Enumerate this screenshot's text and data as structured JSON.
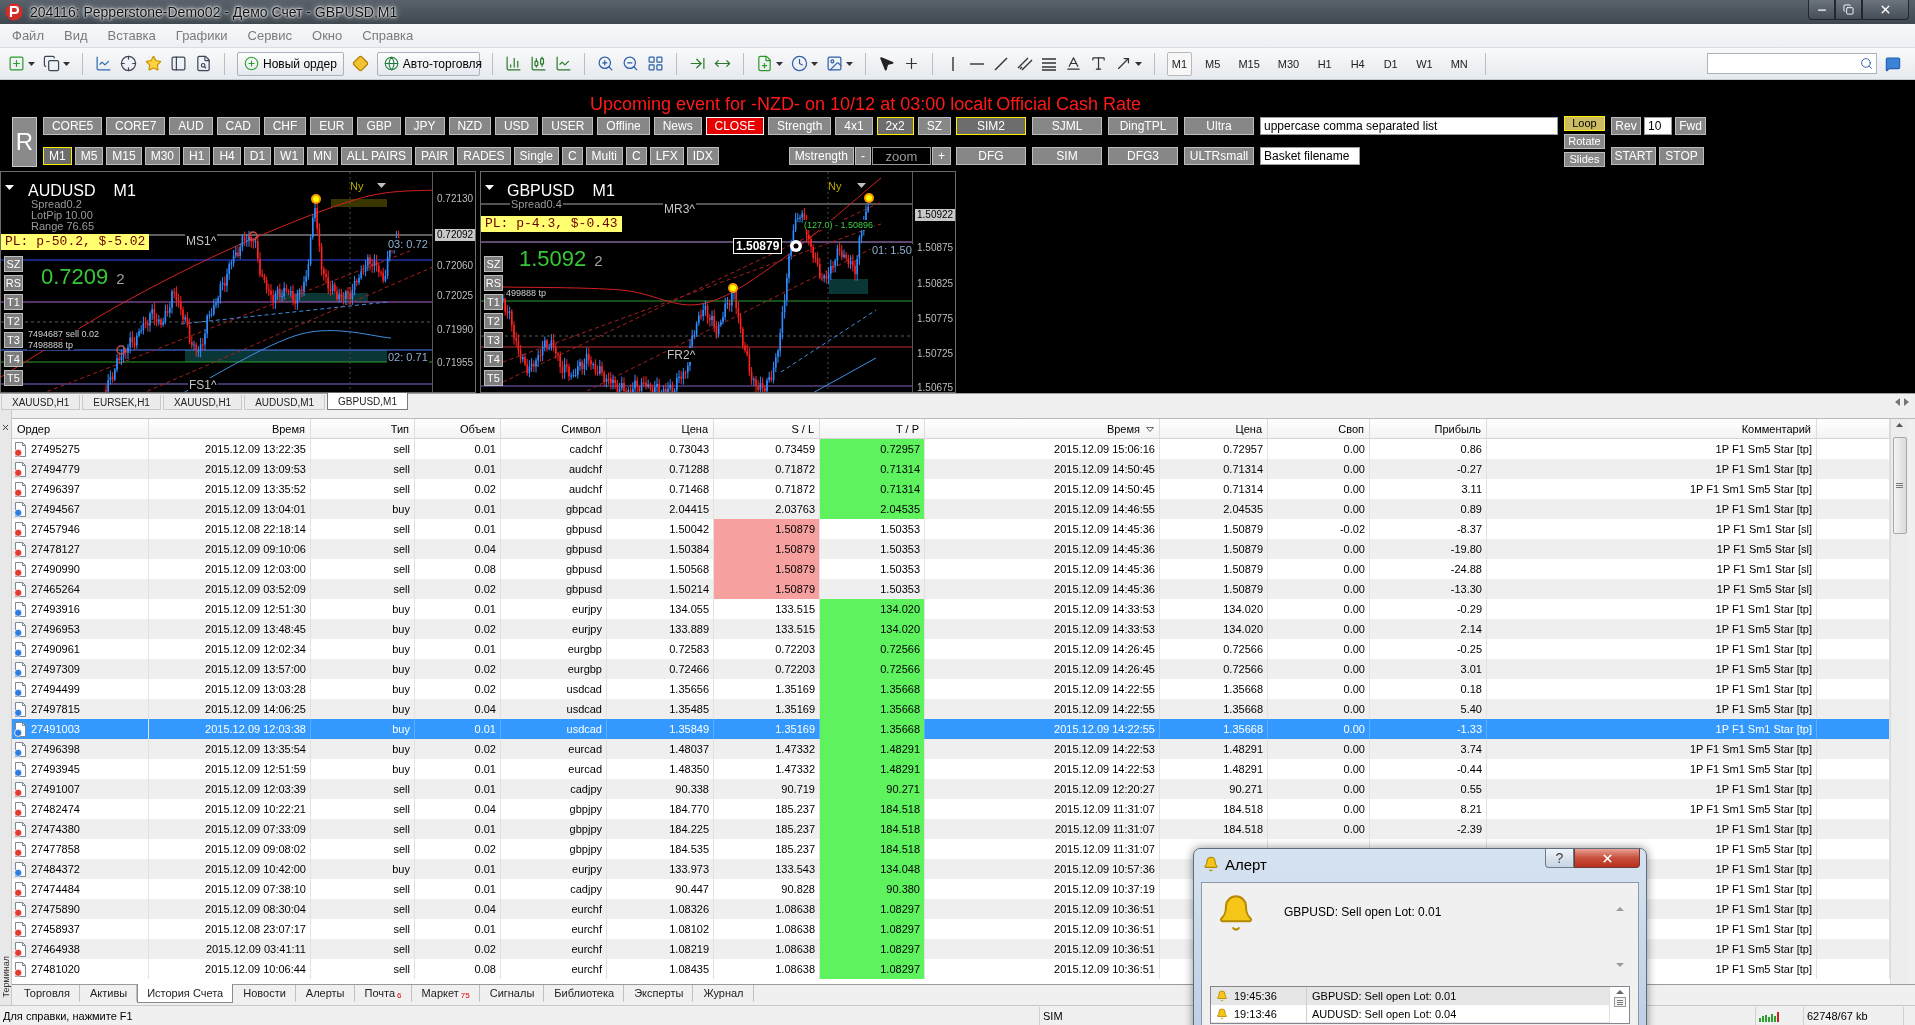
{
  "window": {
    "title": "204116: Pepperstone-Demo02 - Демо Счет - GBPUSD,M1"
  },
  "menu": [
    "Файл",
    "Вид",
    "Вставка",
    "Графики",
    "Сервис",
    "Окно",
    "Справка"
  ],
  "toolbar": {
    "new_order": "Новый ордер",
    "autotrading": "Авто-торговля",
    "periods": [
      {
        "label": "M1",
        "selected": true
      },
      {
        "label": "M5",
        "selected": false
      },
      {
        "label": "M15",
        "selected": false
      },
      {
        "label": "M30",
        "selected": false
      },
      {
        "label": "H1",
        "selected": false
      },
      {
        "label": "H4",
        "selected": false
      },
      {
        "label": "D1",
        "selected": false
      },
      {
        "label": "W1",
        "selected": false
      },
      {
        "label": "MN",
        "selected": false
      }
    ]
  },
  "panel": {
    "headline": [
      "Upcoming event for -NZD- on 10/12 at 03:00 localt",
      "Official Cash Rate"
    ],
    "r_button": "R",
    "row1": [
      {
        "label": "CORE5",
        "kind": "std",
        "selected": false
      },
      {
        "label": "CORE7",
        "kind": "std",
        "selected": false
      },
      {
        "label": "AUD",
        "kind": "std",
        "selected": false
      },
      {
        "label": "CAD",
        "kind": "std",
        "selected": false
      },
      {
        "label": "CHF",
        "kind": "std",
        "selected": false
      },
      {
        "label": "EUR",
        "kind": "std",
        "selected": false
      },
      {
        "label": "GBP",
        "kind": "std",
        "selected": false
      },
      {
        "label": "JPY",
        "kind": "std",
        "selected": false
      },
      {
        "label": "NZD",
        "kind": "std",
        "selected": false
      },
      {
        "label": "USD",
        "kind": "std",
        "selected": false
      },
      {
        "label": "USER",
        "kind": "std",
        "selected": false
      },
      {
        "label": "Offline",
        "kind": "std",
        "selected": false
      },
      {
        "label": "News",
        "kind": "std",
        "selected": false
      },
      {
        "label": "CLOSE",
        "kind": "alert",
        "selected": false
      },
      {
        "label": "Strength",
        "kind": "std",
        "selected": false
      },
      {
        "label": "4x1",
        "kind": "std",
        "selected": false
      },
      {
        "label": "2x2",
        "kind": "std",
        "selected": true
      },
      {
        "label": "SZ",
        "kind": "std",
        "selected": false
      }
    ],
    "row2": [
      {
        "label": "M1",
        "selected": true
      },
      {
        "label": "M5",
        "selected": false
      },
      {
        "label": "M15",
        "selected": false
      },
      {
        "label": "M30",
        "selected": false
      },
      {
        "label": "H1",
        "selected": false
      },
      {
        "label": "H4",
        "selected": false
      },
      {
        "label": "D1",
        "selected": false
      },
      {
        "label": "W1",
        "selected": false
      },
      {
        "label": "MN",
        "selected": false
      },
      {
        "label": "ALL PAIRS",
        "selected": false
      },
      {
        "label": "PAIR",
        "selected": false
      },
      {
        "label": "RADES",
        "selected": false
      },
      {
        "label": "Single",
        "selected": false
      },
      {
        "label": "C",
        "selected": false
      },
      {
        "label": "Multi",
        "selected": false
      },
      {
        "label": "C",
        "selected": false
      },
      {
        "label": "LFX",
        "selected": false
      },
      {
        "label": "IDX",
        "selected": false
      }
    ],
    "strength": {
      "label": "Mstrength",
      "minus": "-",
      "zoom": {
        "placeholder": "zoom"
      },
      "plus": "+"
    },
    "grid": [
      [
        {
          "label": "SIM2",
          "selected": true
        },
        {
          "label": "SJML",
          "selected": false
        },
        {
          "label": "DingTPL",
          "selected": false
        },
        {
          "label": "Ultra",
          "selected": false
        }
      ],
      [
        {
          "label": "DFG",
          "selected": false
        },
        {
          "label": "SIM",
          "selected": false
        },
        {
          "label": "DFG3",
          "selected": false
        },
        {
          "label": "ULTRsmall",
          "selected": false
        }
      ]
    ],
    "pairs_field": {
      "value": "uppercase comma separated list"
    },
    "basket_field": {
      "value": "Basket filename"
    },
    "slideshow": [
      {
        "label": "Loop",
        "selected": true
      },
      {
        "label": "Rotate",
        "selected": false
      },
      {
        "label": "Slides",
        "selected": false
      }
    ],
    "nav": {
      "rev": "Rev",
      "step": {
        "value": "10"
      },
      "fwd": "Fwd"
    },
    "run": [
      "START",
      "STOP"
    ]
  },
  "charts": [
    {
      "symbol": "AUDUSD",
      "period": "M1",
      "info": [
        "Spread0.2",
        "LotPip 10.00",
        "Range 76.65"
      ],
      "pl": "PL: p-50.2, $-5.02",
      "price": "0.7209",
      "price_digit": "2",
      "session": "Ny",
      "pivots": [
        "MS1^",
        "FS1^"
      ],
      "orders": [
        "7494687 sell 0.02",
        "7498888 tp"
      ],
      "targets": [
        "03: 0.72",
        "02: 0.71"
      ],
      "side_buttons": [
        "SZ",
        "RS",
        "T1",
        "T2",
        "T3",
        "T4",
        "T5"
      ],
      "axis": [
        {
          "label": "0.72130",
          "current": false
        },
        {
          "label": "0.72092",
          "current": true
        },
        {
          "label": "0.72060",
          "current": false
        },
        {
          "label": "0.72025",
          "current": false
        },
        {
          "label": "0.71990",
          "current": false
        },
        {
          "label": "0.71955",
          "current": false
        }
      ]
    },
    {
      "symbol": "GBPUSD",
      "period": "M1",
      "info": [
        "Spread0.4"
      ],
      "pl": "PL: p-4.3, $-0.43",
      "price": "1.5092",
      "price_digit": "2",
      "session": "Ny",
      "pivots": [
        "MR3^",
        "FR2^"
      ],
      "orders": [
        "499888 tp"
      ],
      "targets": [
        "01: 1.50"
      ],
      "marker": "1.50879",
      "level_text": "(127.0) - 1.50896",
      "side_buttons": [
        "SZ",
        "RS",
        "T1",
        "T2",
        "T3",
        "T4",
        "T5"
      ],
      "axis": [
        {
          "label": "1.50922",
          "current": true
        },
        {
          "label": "1.50875",
          "current": false
        },
        {
          "label": "1.50825",
          "current": false
        },
        {
          "label": "1.50775",
          "current": false
        },
        {
          "label": "1.50725",
          "current": false
        },
        {
          "label": "1.50675",
          "current": false
        }
      ]
    }
  ],
  "chart_tabs": [
    {
      "label": "XAUUSD,H1",
      "selected": false
    },
    {
      "label": "EURSEK,H1",
      "selected": false
    },
    {
      "label": "XAUUSD,H1",
      "selected": false
    },
    {
      "label": "AUDUSD,M1",
      "selected": false
    },
    {
      "label": "GBPUSD,M1",
      "selected": true
    }
  ],
  "terminal": {
    "label": "Терминал",
    "table": {
      "columns": [
        {
          "label": "Ордер",
          "sorted": false
        },
        {
          "label": "Время",
          "sorted": false
        },
        {
          "label": "Тип",
          "sorted": false
        },
        {
          "label": "Объем",
          "sorted": false
        },
        {
          "label": "Символ",
          "sorted": false
        },
        {
          "label": "Цена",
          "sorted": false
        },
        {
          "label": "S / L",
          "sorted": false
        },
        {
          "label": "T / P",
          "sorted": false
        },
        {
          "label": "Время",
          "sorted": true
        },
        {
          "label": "Цена",
          "sorted": false
        },
        {
          "label": "Своп",
          "sorted": false
        },
        {
          "label": "Прибыль",
          "sorted": false
        },
        {
          "label": "Комментарий",
          "sorted": false
        }
      ],
      "rows": [
        {
          "order": "27495275",
          "time": "2015.12.09 13:22:35",
          "type": "sell",
          "kind": "sell",
          "volume": "0.01",
          "symbol": "cadchf",
          "price": "0.73043",
          "sl": "0.73459",
          "tp": "0.72957",
          "close_time": "2015.12.09 15:06:16",
          "close_price": "0.72957",
          "swap": "0.00",
          "profit": "0.86",
          "comment": "1P F1 Sm5 Star [tp]",
          "sl_hit": false,
          "tp_hit": true,
          "selected": false
        },
        {
          "order": "27494779",
          "time": "2015.12.09 13:09:53",
          "type": "sell",
          "kind": "sell",
          "volume": "0.01",
          "symbol": "audchf",
          "price": "0.71288",
          "sl": "0.71872",
          "tp": "0.71314",
          "close_time": "2015.12.09 14:50:45",
          "close_price": "0.71314",
          "swap": "0.00",
          "profit": "-0.27",
          "comment": "1P F1 Sm1 Star [tp]",
          "sl_hit": false,
          "tp_hit": true,
          "selected": false
        },
        {
          "order": "27496397",
          "time": "2015.12.09 13:35:52",
          "type": "sell",
          "kind": "sell",
          "volume": "0.02",
          "symbol": "audchf",
          "price": "0.71468",
          "sl": "0.71872",
          "tp": "0.71314",
          "close_time": "2015.12.09 14:50:45",
          "close_price": "0.71314",
          "swap": "0.00",
          "profit": "3.11",
          "comment": "1P F1 Sm1 Sm5 Star [tp]",
          "sl_hit": false,
          "tp_hit": true,
          "selected": false
        },
        {
          "order": "27494567",
          "time": "2015.12.09 13:04:01",
          "type": "buy",
          "kind": "buy",
          "volume": "0.01",
          "symbol": "gbpcad",
          "price": "2.04415",
          "sl": "2.03763",
          "tp": "2.04535",
          "close_time": "2015.12.09 14:46:55",
          "close_price": "2.04535",
          "swap": "0.00",
          "profit": "0.89",
          "comment": "1P F1 Sm1 Star [tp]",
          "sl_hit": false,
          "tp_hit": true,
          "selected": false
        },
        {
          "order": "27457946",
          "time": "2015.12.08 22:18:14",
          "type": "sell",
          "kind": "sell",
          "volume": "0.01",
          "symbol": "gbpusd",
          "price": "1.50042",
          "sl": "1.50879",
          "tp": "1.50353",
          "close_time": "2015.12.09 14:45:36",
          "close_price": "1.50879",
          "swap": "-0.02",
          "profit": "-8.37",
          "comment": "1P F1 Sm1 Star [sl]",
          "sl_hit": true,
          "tp_hit": false,
          "selected": false
        },
        {
          "order": "27478127",
          "time": "2015.12.09 09:10:06",
          "type": "sell",
          "kind": "sell",
          "volume": "0.04",
          "symbol": "gbpusd",
          "price": "1.50384",
          "sl": "1.50879",
          "tp": "1.50353",
          "close_time": "2015.12.09 14:45:36",
          "close_price": "1.50879",
          "swap": "0.00",
          "profit": "-19.80",
          "comment": "1P F1 Sm5 Star [sl]",
          "sl_hit": true,
          "tp_hit": false,
          "selected": false
        },
        {
          "order": "27490990",
          "time": "2015.12.09 12:03:00",
          "type": "sell",
          "kind": "sell",
          "volume": "0.08",
          "symbol": "gbpusd",
          "price": "1.50568",
          "sl": "1.50879",
          "tp": "1.50353",
          "close_time": "2015.12.09 14:45:36",
          "close_price": "1.50879",
          "swap": "0.00",
          "profit": "-24.88",
          "comment": "1P F1 Sm1 Star [sl]",
          "sl_hit": true,
          "tp_hit": false,
          "selected": false
        },
        {
          "order": "27465264",
          "time": "2015.12.09 03:52:09",
          "type": "sell",
          "kind": "sell",
          "volume": "0.02",
          "symbol": "gbpusd",
          "price": "1.50214",
          "sl": "1.50879",
          "tp": "1.50353",
          "close_time": "2015.12.09 14:45:36",
          "close_price": "1.50879",
          "swap": "0.00",
          "profit": "-13.30",
          "comment": "1P F1 Sm5 Star [sl]",
          "sl_hit": true,
          "tp_hit": false,
          "selected": false
        },
        {
          "order": "27493916",
          "time": "2015.12.09 12:51:30",
          "type": "buy",
          "kind": "buy",
          "volume": "0.01",
          "symbol": "eurjpy",
          "price": "134.055",
          "sl": "133.515",
          "tp": "134.020",
          "close_time": "2015.12.09 14:33:53",
          "close_price": "134.020",
          "swap": "0.00",
          "profit": "-0.29",
          "comment": "1P F1 Sm1 Star [tp]",
          "sl_hit": false,
          "tp_hit": true,
          "selected": false
        },
        {
          "order": "27496953",
          "time": "2015.12.09 13:48:45",
          "type": "buy",
          "kind": "buy",
          "volume": "0.02",
          "symbol": "eurjpy",
          "price": "133.889",
          "sl": "133.515",
          "tp": "134.020",
          "close_time": "2015.12.09 14:33:53",
          "close_price": "134.020",
          "swap": "0.00",
          "profit": "2.14",
          "comment": "1P F1 Sm5 Star [tp]",
          "sl_hit": false,
          "tp_hit": true,
          "selected": false
        },
        {
          "order": "27490961",
          "time": "2015.12.09 12:02:34",
          "type": "buy",
          "kind": "buy",
          "volume": "0.01",
          "symbol": "eurgbp",
          "price": "0.72583",
          "sl": "0.72203",
          "tp": "0.72566",
          "close_time": "2015.12.09 14:26:45",
          "close_price": "0.72566",
          "swap": "0.00",
          "profit": "-0.25",
          "comment": "1P F1 Sm1 Star [tp]",
          "sl_hit": false,
          "tp_hit": true,
          "selected": false
        },
        {
          "order": "27497309",
          "time": "2015.12.09 13:57:00",
          "type": "buy",
          "kind": "buy",
          "volume": "0.02",
          "symbol": "eurgbp",
          "price": "0.72466",
          "sl": "0.72203",
          "tp": "0.72566",
          "close_time": "2015.12.09 14:26:45",
          "close_price": "0.72566",
          "swap": "0.00",
          "profit": "3.01",
          "comment": "1P F1 Sm5 Star [tp]",
          "sl_hit": false,
          "tp_hit": true,
          "selected": false
        },
        {
          "order": "27494499",
          "time": "2015.12.09 13:03:28",
          "type": "buy",
          "kind": "buy",
          "volume": "0.02",
          "symbol": "usdcad",
          "price": "1.35656",
          "sl": "1.35169",
          "tp": "1.35668",
          "close_time": "2015.12.09 14:22:55",
          "close_price": "1.35668",
          "swap": "0.00",
          "profit": "0.18",
          "comment": "1P F1 Sm1 Star [tp]",
          "sl_hit": false,
          "tp_hit": true,
          "selected": false
        },
        {
          "order": "27497815",
          "time": "2015.12.09 14:06:25",
          "type": "buy",
          "kind": "buy",
          "volume": "0.04",
          "symbol": "usdcad",
          "price": "1.35485",
          "sl": "1.35169",
          "tp": "1.35668",
          "close_time": "2015.12.09 14:22:55",
          "close_price": "1.35668",
          "swap": "0.00",
          "profit": "5.40",
          "comment": "1P F1 Sm5 Star [tp]",
          "sl_hit": false,
          "tp_hit": true,
          "selected": false
        },
        {
          "order": "27491003",
          "time": "2015.12.09 12:03:38",
          "type": "buy",
          "kind": "buy",
          "volume": "0.01",
          "symbol": "usdcad",
          "price": "1.35849",
          "sl": "1.35169",
          "tp": "1.35668",
          "close_time": "2015.12.09 14:22:55",
          "close_price": "1.35668",
          "swap": "0.00",
          "profit": "-1.33",
          "comment": "1P F1 Sm1 Star [tp]",
          "sl_hit": false,
          "tp_hit": true,
          "selected": true
        },
        {
          "order": "27496398",
          "time": "2015.12.09 13:35:54",
          "type": "buy",
          "kind": "buy",
          "volume": "0.02",
          "symbol": "eurcad",
          "price": "1.48037",
          "sl": "1.47332",
          "tp": "1.48291",
          "close_time": "2015.12.09 14:22:53",
          "close_price": "1.48291",
          "swap": "0.00",
          "profit": "3.74",
          "comment": "1P F1 Sm1 Sm5 Star [tp]",
          "sl_hit": false,
          "tp_hit": true,
          "selected": false
        },
        {
          "order": "27493945",
          "time": "2015.12.09 12:51:59",
          "type": "buy",
          "kind": "buy",
          "volume": "0.01",
          "symbol": "eurcad",
          "price": "1.48350",
          "sl": "1.47332",
          "tp": "1.48291",
          "close_time": "2015.12.09 14:22:53",
          "close_price": "1.48291",
          "swap": "0.00",
          "profit": "-0.44",
          "comment": "1P F1 Sm1 Sm5 Star [tp]",
          "sl_hit": false,
          "tp_hit": true,
          "selected": false
        },
        {
          "order": "27491007",
          "time": "2015.12.09 12:03:39",
          "type": "sell",
          "kind": "sell",
          "volume": "0.01",
          "symbol": "cadjpy",
          "price": "90.338",
          "sl": "90.719",
          "tp": "90.271",
          "close_time": "2015.12.09 12:20:27",
          "close_price": "90.271",
          "swap": "0.00",
          "profit": "0.55",
          "comment": "1P F1 Sm1 Star [tp]",
          "sl_hit": false,
          "tp_hit": true,
          "selected": false
        },
        {
          "order": "27482474",
          "time": "2015.12.09 10:22:21",
          "type": "sell",
          "kind": "sell",
          "volume": "0.04",
          "symbol": "gbpjpy",
          "price": "184.770",
          "sl": "185.237",
          "tp": "184.518",
          "close_time": "2015.12.09 11:31:07",
          "close_price": "184.518",
          "swap": "0.00",
          "profit": "8.21",
          "comment": "1P F1 Sm1 Sm5 Star [tp]",
          "sl_hit": false,
          "tp_hit": true,
          "selected": false
        },
        {
          "order": "27474380",
          "time": "2015.12.09 07:33:09",
          "type": "sell",
          "kind": "sell",
          "volume": "0.01",
          "symbol": "gbpjpy",
          "price": "184.225",
          "sl": "185.237",
          "tp": "184.518",
          "close_time": "2015.12.09 11:31:07",
          "close_price": "184.518",
          "swap": "0.00",
          "profit": "-2.39",
          "comment": "1P F1 Sm1 Star [tp]",
          "sl_hit": false,
          "tp_hit": true,
          "selected": false
        },
        {
          "order": "27477858",
          "time": "2015.12.09 09:08:02",
          "type": "sell",
          "kind": "sell",
          "volume": "0.02",
          "symbol": "gbpjpy",
          "price": "184.535",
          "sl": "185.237",
          "tp": "184.518",
          "close_time": "2015.12.09 11:31:07",
          "comment": "1P F1 Sm5 Star [tp]",
          "sl_hit": false,
          "tp_hit": true,
          "selected": false
        },
        {
          "order": "27484372",
          "time": "2015.12.09 10:42:00",
          "type": "buy",
          "kind": "buy",
          "volume": "0.01",
          "symbol": "eurjpy",
          "price": "133.973",
          "sl": "133.543",
          "tp": "134.048",
          "close_time": "2015.12.09 10:57:36",
          "comment": "1P F1 Sm1 Star [tp]",
          "sl_hit": false,
          "tp_hit": true,
          "selected": false
        },
        {
          "order": "27474484",
          "time": "2015.12.09 07:38:10",
          "type": "sell",
          "kind": "sell",
          "volume": "0.01",
          "symbol": "cadjpy",
          "price": "90.447",
          "sl": "90.828",
          "tp": "90.380",
          "close_time": "2015.12.09 10:37:19",
          "comment": "1P F1 Sm1 Star [tp]",
          "sl_hit": false,
          "tp_hit": true,
          "selected": false
        },
        {
          "order": "27475890",
          "time": "2015.12.09 08:30:04",
          "type": "sell",
          "kind": "sell",
          "volume": "0.04",
          "symbol": "eurchf",
          "price": "1.08326",
          "sl": "1.08638",
          "tp": "1.08297",
          "close_time": "2015.12.09 10:36:51",
          "comment": "1P F1 Sm1 Star [tp]",
          "sl_hit": false,
          "tp_hit": true,
          "selected": false
        },
        {
          "order": "27458937",
          "time": "2015.12.08 23:07:17",
          "type": "sell",
          "kind": "sell",
          "volume": "0.01",
          "symbol": "eurchf",
          "price": "1.08102",
          "sl": "1.08638",
          "tp": "1.08297",
          "close_time": "2015.12.09 10:36:51",
          "comment": "1P F1 Sm1 Star [tp]",
          "sl_hit": false,
          "tp_hit": true,
          "selected": false
        },
        {
          "order": "27464938",
          "time": "2015.12.09 03:41:11",
          "type": "sell",
          "kind": "sell",
          "volume": "0.02",
          "symbol": "eurchf",
          "price": "1.08219",
          "sl": "1.08638",
          "tp": "1.08297",
          "close_time": "2015.12.09 10:36:51",
          "comment": "1P F1 Sm5 Star [tp]",
          "sl_hit": false,
          "tp_hit": true,
          "selected": false
        },
        {
          "order": "27481020",
          "time": "2015.12.09 10:06:44",
          "type": "sell",
          "kind": "sell",
          "volume": "0.08",
          "symbol": "eurchf",
          "price": "1.08435",
          "sl": "1.08638",
          "tp": "1.08297",
          "close_time": "2015.12.09 10:36:51",
          "comment": "1P F1 Sm5 Star [tp]",
          "sl_hit": false,
          "tp_hit": true,
          "selected": false
        }
      ]
    },
    "tabs": [
      {
        "label": "Торговля",
        "selected": false
      },
      {
        "label": "Активы",
        "selected": false
      },
      {
        "label": "История Счета",
        "selected": true
      },
      {
        "label": "Новости",
        "selected": false
      },
      {
        "label": "Алерты",
        "selected": false
      },
      {
        "label": "Почта",
        "count": "6",
        "selected": false
      },
      {
        "label": "Маркет",
        "count": "75",
        "selected": false
      },
      {
        "label": "Сигналы",
        "selected": false
      },
      {
        "label": "Библиотека",
        "selected": false
      },
      {
        "label": "Эксперты",
        "selected": false
      },
      {
        "label": "Журнал",
        "selected": false
      }
    ]
  },
  "status_bar": {
    "help": "Для справки, нажмите F1",
    "profile": "SIM",
    "traffic": "62748/67 kb"
  },
  "alert": {
    "title": "Алерт",
    "help": "?",
    "message": "GBPUSD: Sell open Lot: 0.01",
    "history": [
      {
        "time": "19:45:36",
        "text": "GBPUSD: Sell open Lot: 0.01",
        "selected": true
      },
      {
        "time": "19:13:46",
        "text": "AUDUSD: Sell open Lot: 0.04",
        "selected": false
      }
    ]
  }
}
